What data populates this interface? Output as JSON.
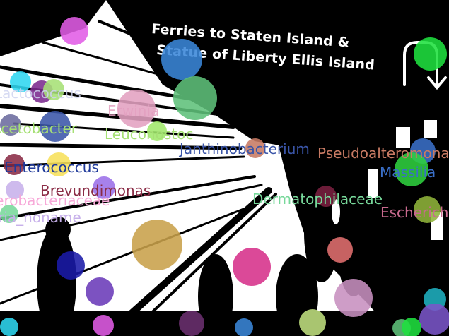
{
  "sign": {
    "line1": "Ferries to Staten Island &",
    "line2": "Statue of Liberty Ellis Island"
  },
  "labels": [
    {
      "text": "Acetobacter",
      "color": "#a6e075"
    },
    {
      "text": "Erwinia",
      "color": "#e3a0c0"
    },
    {
      "text": "Leuconostoc",
      "color": "#a6e075"
    },
    {
      "text": "Janthinobacterium",
      "color": "#3a55a8"
    },
    {
      "text": "Pseudoalteromonas",
      "color": "#c77a63"
    },
    {
      "text": "Massilia",
      "color": "#3a6fc8"
    },
    {
      "text": "Enterococcus",
      "color": "#1f3a9a"
    },
    {
      "text": "Brevundimonas",
      "color": "#8a2b45"
    },
    {
      "text": "Enterobacteriaceae",
      "color": "#f7a8d8"
    },
    {
      "text": "Bacteria_noname",
      "color": "#c7b0ea"
    },
    {
      "text": "Dermatophilaceae",
      "color": "#77d89a"
    },
    {
      "text": "Escherichia",
      "color": "#c86a8e"
    },
    {
      "text": "Lactococcus",
      "color": "#cfd4f0"
    }
  ],
  "bubble_colors": [
    "#e15ce6",
    "#3a86d8",
    "#5fc07a",
    "#1fe03f",
    "#2fd7f0",
    "#7b2a8e",
    "#a6e075",
    "#e3a0c0",
    "#6b6b9e",
    "#3a55a8",
    "#9fe86a",
    "#c77a63",
    "#3a6fc8",
    "#2fd03f",
    "#f7e05a",
    "#8a2b45",
    "#c7b0ea",
    "#9b6fe8",
    "#77d89a",
    "#7a2040",
    "#8fb43a",
    "#c8a04a",
    "#e27070",
    "#1a1aa8",
    "#d6308a",
    "#6a3ab8",
    "#c78fbf",
    "#1fb0c0",
    "#7a55c8",
    "#c0e080",
    "#6b3070"
  ]
}
